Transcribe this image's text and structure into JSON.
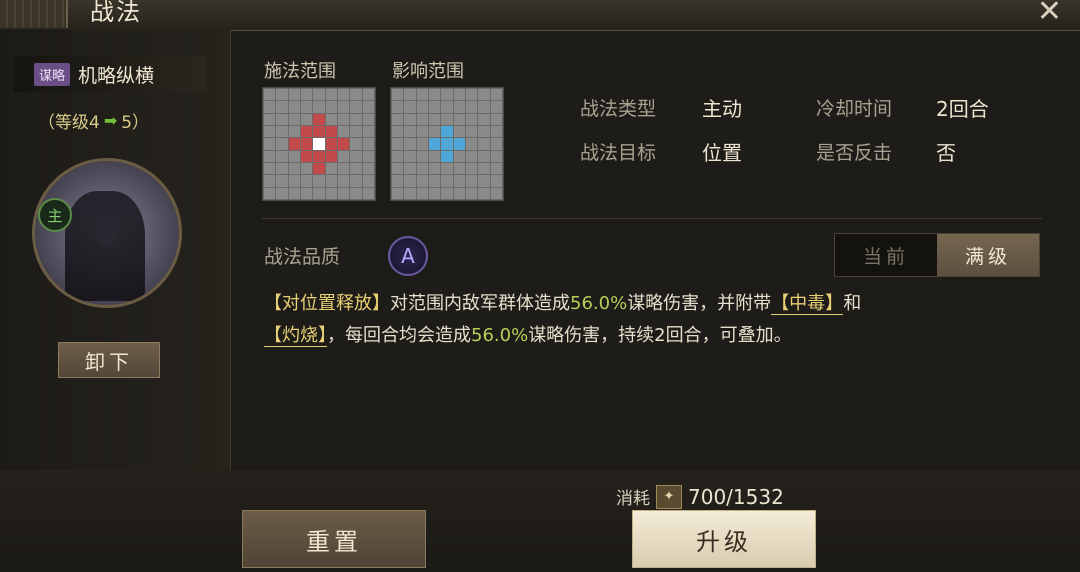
{
  "header": {
    "title": "战法",
    "close_icon": "close-icon"
  },
  "left": {
    "type_badge": "谋略",
    "skill_name": "机略纵横",
    "level_prefix": "（等级4",
    "level_suffix": "5）",
    "arrow_icon": "arrow-right-icon",
    "main_badge": "主",
    "unequip_label": "卸下"
  },
  "grids": {
    "cast_label": "施法范围",
    "effect_label": "影响范围",
    "cast_cells": [
      "0,0,0,0,0,0,0,0,0",
      "0,0,0,0,0,0,0,0,0",
      "0,0,0,0,1,0,0,0,0",
      "0,0,0,1,1,1,0,0,0",
      "0,0,1,1,2,1,1,0,0",
      "0,0,0,1,1,1,0,0,0",
      "0,0,0,0,1,0,0,0,0",
      "0,0,0,0,0,0,0,0,0",
      "0,0,0,0,0,0,0,0,0"
    ],
    "effect_cells": [
      "0,0,0,0,0,0,0,0,0",
      "0,0,0,0,0,0,0,0,0",
      "0,0,0,0,0,0,0,0,0",
      "0,0,0,0,3,0,0,0,0",
      "0,0,0,3,3,3,0,0,0",
      "0,0,0,0,3,0,0,0,0",
      "0,0,0,0,0,0,0,0,0",
      "0,0,0,0,0,0,0,0,0",
      "0,0,0,0,0,0,0,0,0"
    ],
    "colors": {
      "empty": "#8a8a8a",
      "cast": "#c24a4a",
      "effect": "#4fa7d8",
      "center": "#ffffff"
    }
  },
  "info": {
    "type_label": "战法类型",
    "type_value": "主动",
    "cooldown_label": "冷却时间",
    "cooldown_value": "2回合",
    "target_label": "战法目标",
    "target_value": "位置",
    "counter_label": "是否反击",
    "counter_value": "否"
  },
  "quality": {
    "label": "战法品质",
    "grade": "A"
  },
  "toggle": {
    "current": "当前",
    "max": "满级",
    "selected": "满级"
  },
  "description": {
    "p1": "【对位置释放】",
    "p2": "对范围内敌军群体造成",
    "p3": "56.0%",
    "p4": "谋略伤害，并附带",
    "p5": "【中毒】",
    "p6": "和",
    "p7": "【灼烧】",
    "p8": "，每回合均会造成",
    "p9": "56.0%",
    "p10": "谋略伤害，持续2回合，可叠加。"
  },
  "footer": {
    "reset_label": "重置",
    "upgrade_label": "升级",
    "cost_label": "消耗",
    "cost_value": "700/1532"
  },
  "colors": {
    "accent": "#e7cf74",
    "number": "#b4cf5a",
    "badge": "#6a4f86"
  }
}
